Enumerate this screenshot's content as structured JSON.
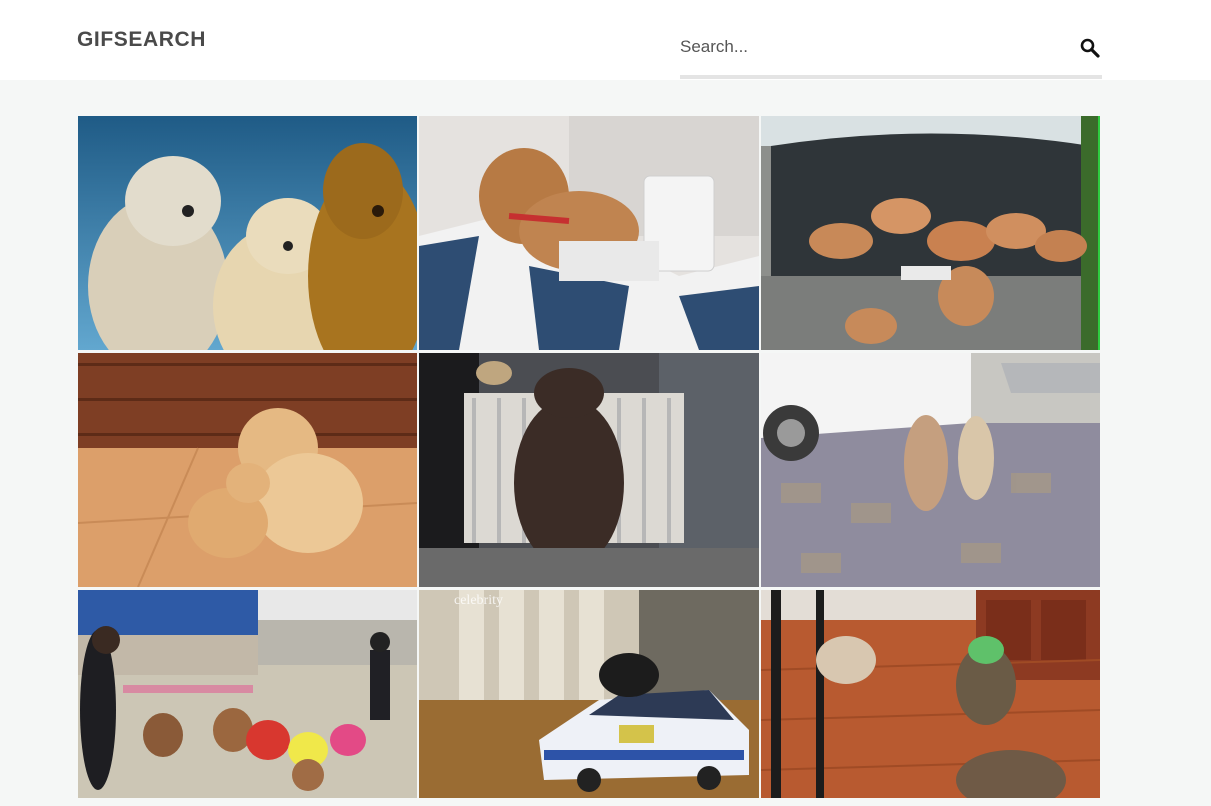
{
  "header": {
    "logo": "GIFSEARCH",
    "search_placeholder": "Search...",
    "search_value": "",
    "search_icon": "search-icon"
  },
  "results": [
    {
      "name": "gif-dogs-praying",
      "watermark": ""
    },
    {
      "name": "gif-shiba-laptop",
      "watermark": ""
    },
    {
      "name": "gif-puppies-car-trunk",
      "watermark": ""
    },
    {
      "name": "gif-golden-retrievers",
      "watermark": ""
    },
    {
      "name": "gif-dog-at-gate",
      "watermark": ""
    },
    {
      "name": "gif-dogs-dancing-street",
      "watermark": ""
    },
    {
      "name": "gif-dogs-trained-performing",
      "watermark": ""
    },
    {
      "name": "gif-dog-toy-police-car",
      "watermark": "celebrity"
    },
    {
      "name": "gif-pug-yoda-costume",
      "watermark": ""
    }
  ]
}
